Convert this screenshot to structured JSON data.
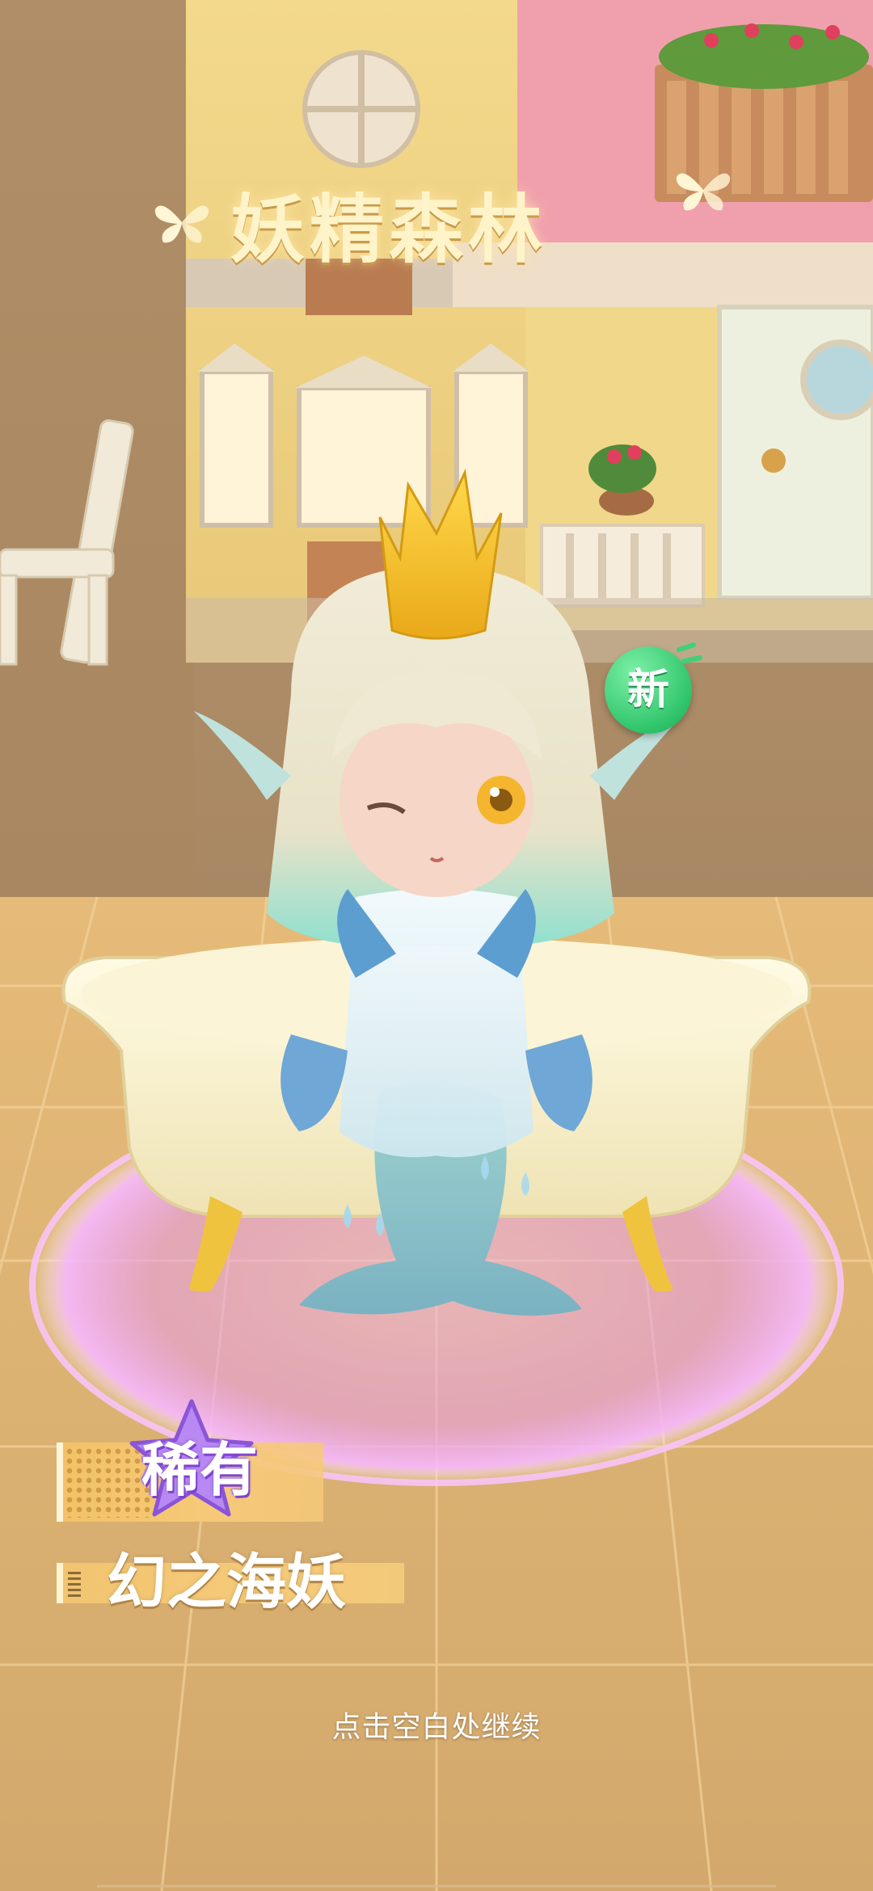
{
  "scene": {
    "location_title": "妖精森林",
    "new_badge": "新",
    "rarity_label": "稀有",
    "character_name": "幻之海妖",
    "continue_hint": "点击空白处继续"
  },
  "icons": {
    "title_decoration": "butterfly-icon",
    "rarity_frame": "star-icon"
  },
  "colors": {
    "title_text": "#fff4c9",
    "new_badge": "#2fc46a",
    "rarity_purple": "#8f5ad8",
    "label_bar_gold": "#f2c470",
    "platform_glow": "#e49cf0"
  }
}
